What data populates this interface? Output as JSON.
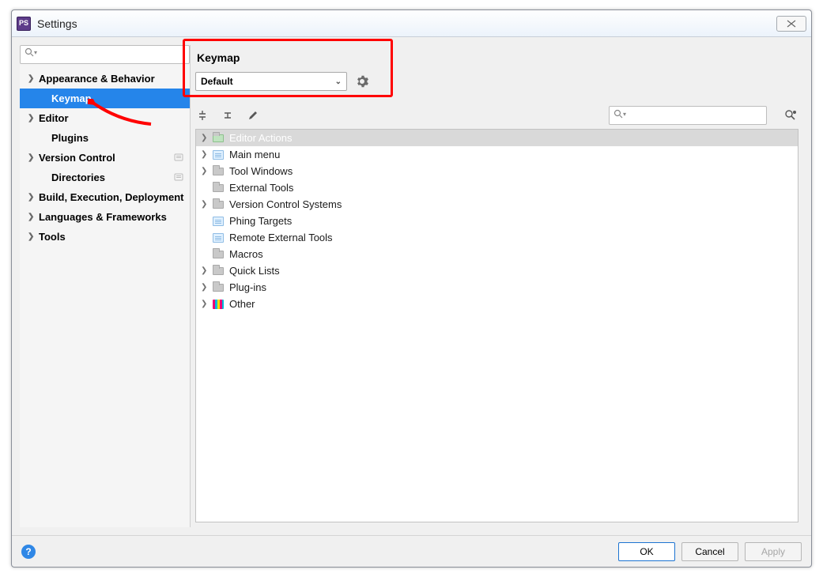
{
  "window": {
    "title": "Settings",
    "app_badge": "PS"
  },
  "sidebar": {
    "search_placeholder": "",
    "items": [
      {
        "label": "Appearance & Behavior",
        "expandable": true,
        "child": false
      },
      {
        "label": "Keymap",
        "expandable": false,
        "child": true,
        "selected": true
      },
      {
        "label": "Editor",
        "expandable": true,
        "child": false
      },
      {
        "label": "Plugins",
        "expandable": false,
        "child": true
      },
      {
        "label": "Version Control",
        "expandable": true,
        "child": false,
        "badge": true
      },
      {
        "label": "Directories",
        "expandable": false,
        "child": true,
        "badge": true
      },
      {
        "label": "Build, Execution, Deployment",
        "expandable": true,
        "child": false
      },
      {
        "label": "Languages & Frameworks",
        "expandable": true,
        "child": false
      },
      {
        "label": "Tools",
        "expandable": true,
        "child": false
      }
    ]
  },
  "panel": {
    "title": "Keymap",
    "dropdown_value": "Default",
    "search_placeholder": ""
  },
  "tree": [
    {
      "label": "Editor Actions",
      "expandable": true,
      "icon": "folder-green",
      "selected": true
    },
    {
      "label": "Main menu",
      "expandable": true,
      "icon": "folder-blue"
    },
    {
      "label": "Tool Windows",
      "expandable": true,
      "icon": "folder"
    },
    {
      "label": "External Tools",
      "expandable": false,
      "icon": "folder"
    },
    {
      "label": "Version Control Systems",
      "expandable": true,
      "icon": "folder"
    },
    {
      "label": "Phing Targets",
      "expandable": false,
      "icon": "folder-blue"
    },
    {
      "label": "Remote External Tools",
      "expandable": false,
      "icon": "folder-blue"
    },
    {
      "label": "Macros",
      "expandable": false,
      "icon": "folder"
    },
    {
      "label": "Quick Lists",
      "expandable": true,
      "icon": "folder"
    },
    {
      "label": "Plug-ins",
      "expandable": true,
      "icon": "folder"
    },
    {
      "label": "Other",
      "expandable": true,
      "icon": "other"
    }
  ],
  "footer": {
    "ok": "OK",
    "cancel": "Cancel",
    "apply": "Apply"
  }
}
